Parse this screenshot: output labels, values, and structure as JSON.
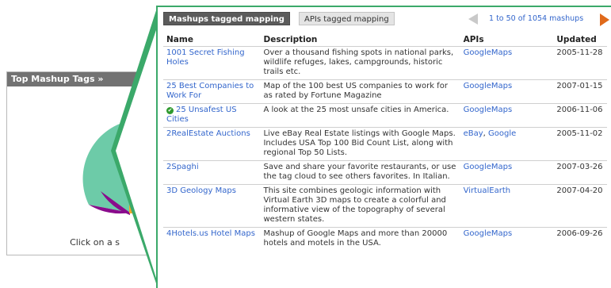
{
  "widget": {
    "title": "Top Mashup Tags »",
    "footer": "Click on a s"
  },
  "tabs": {
    "active": "Mashups tagged mapping",
    "inactive": "APIs tagged mapping"
  },
  "pager": {
    "text": "1 to 50 of 1054 mashups"
  },
  "table": {
    "headers": {
      "name": "Name",
      "description": "Description",
      "apis": "APIs",
      "updated": "Updated"
    },
    "rows": [
      {
        "name": "1001 Secret Fishing Holes",
        "description": "Over a thousand fishing spots in national parks, wildlife refuges, lakes, campgrounds, historic trails etc.",
        "apis": [
          {
            "label": "GoogleMaps"
          }
        ],
        "updated": "2005-11-28",
        "verified": false
      },
      {
        "name": "25 Best Companies to Work For",
        "description": "Map of the 100 best US companies to work for as rated by Fortune Magazine",
        "apis": [
          {
            "label": "GoogleMaps"
          }
        ],
        "updated": "2007-01-15",
        "verified": false
      },
      {
        "name": "25 Unsafest US Cities",
        "description": "A look at the 25 most unsafe cities in America.",
        "apis": [
          {
            "label": "GoogleMaps"
          }
        ],
        "updated": "2006-11-06",
        "verified": true
      },
      {
        "name": "2RealEstate Auctions",
        "description": "Live eBay Real Estate listings with Google Maps. Includes USA Top 100 Bid Count List, along with regional Top 50 Lists.",
        "apis": [
          {
            "label": "eBay"
          },
          {
            "label": "Google"
          }
        ],
        "updated": "2005-11-02",
        "verified": false
      },
      {
        "name": "2Spaghi",
        "description": "Save and share your favorite restaurants, or use the tag cloud to see others favorites. In Italian.",
        "apis": [
          {
            "label": "GoogleMaps"
          }
        ],
        "updated": "2007-03-26",
        "verified": false
      },
      {
        "name": "3D Geology Maps",
        "description": "This site combines geologic information with Virtual Earth 3D maps to create a colorful and informative view of the topography of several western states.",
        "apis": [
          {
            "label": "VirtualEarth"
          }
        ],
        "updated": "2007-04-20",
        "verified": false
      },
      {
        "name": "4Hotels.us Hotel Maps",
        "description": "Mashup of Google Maps and more than 20000 hotels and motels in the USA.",
        "apis": [
          {
            "label": "GoogleMaps"
          }
        ],
        "updated": "2006-09-26",
        "verified": false
      }
    ]
  },
  "colors": {
    "accent_green": "#3ba96a",
    "link_blue": "#3366cc",
    "pie_teal": "#6dcba8",
    "pie_purple": "#8a0b8c",
    "pie_orange": "#f0a92a",
    "next_arrow_orange": "#e06a1b"
  }
}
